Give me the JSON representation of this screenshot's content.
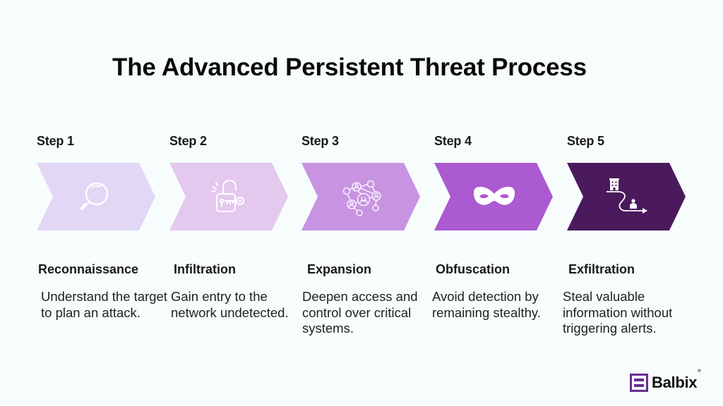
{
  "title": "The Advanced Persistent Threat Process",
  "steps": [
    {
      "label": "Step 1",
      "name": "Reconnaissance",
      "description": "Understand the target to plan an attack.",
      "icon": "magnifying-glass-icon",
      "color": "#e2d7f5"
    },
    {
      "label": "Step 2",
      "name": "Infiltration",
      "description": "Gain entry to the network undetected.",
      "icon": "unlocked-padlock-key-icon",
      "color": "#e4c8ee"
    },
    {
      "label": "Step 3",
      "name": "Expansion",
      "description": "Deepen access and control over critical systems.",
      "icon": "network-people-icon",
      "color": "#c894e2"
    },
    {
      "label": "Step 4",
      "name": "Obfuscation",
      "description": "Avoid detection by remaining stealthy.",
      "icon": "mask-icon",
      "color": "#ab5ad2"
    },
    {
      "label": "Step 5",
      "name": "Exfiltration",
      "description": "Steal valuable information without triggering alerts.",
      "icon": "building-path-person-arrow-icon",
      "color": "#4a1a5c"
    }
  ],
  "brand": {
    "name": "Balbix",
    "registered_mark": "®",
    "color": "#6b2c91"
  }
}
